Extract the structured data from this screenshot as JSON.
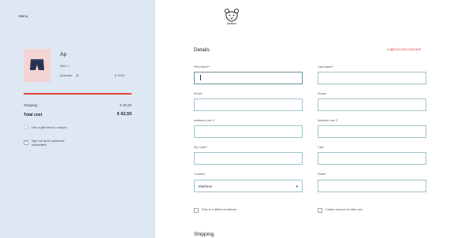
{
  "sidebar": {
    "menu_label": "Menu",
    "product": {
      "name": "Ap",
      "size": "Size: L",
      "quantity_label": "Quantity:",
      "quantity": "2",
      "price": "€ 3293"
    },
    "progress_fraction": 1.0,
    "shipping_label": "Shipping",
    "shipping_value": "€ 25,00",
    "total_label": "Total cost",
    "total_value": "€ 62,93",
    "gift_label": "Use a gift card or coupon",
    "newsletter_label": "Sign me up for awesome newsletters",
    "newsletter_checked": true
  },
  "header": {
    "logo_text": "Ardon"
  },
  "details": {
    "title": "Details",
    "signin_label": "Login to your account",
    "fields": {
      "first_name": {
        "label": "First Name*",
        "value": ""
      },
      "last_name": {
        "label": "Last Name*",
        "value": ""
      },
      "email": {
        "label": "Email*",
        "value": ""
      },
      "phone": {
        "label": "Phone",
        "value": ""
      },
      "address1": {
        "label": "Address Line 1*",
        "value": ""
      },
      "address2": {
        "label": "Address Line 2",
        "value": ""
      },
      "zip": {
        "label": "Zip Code*",
        "value": ""
      },
      "city": {
        "label": "City*",
        "value": ""
      },
      "country": {
        "label": "Country*",
        "value": "Moldova"
      },
      "state": {
        "label": "State*",
        "value": ""
      }
    },
    "ship_different_label": "Ship to a different address",
    "create_account_label": "Create account for later use"
  },
  "shipping": {
    "title": "Shipping"
  },
  "colors": {
    "sidebar_bg": "#dde8f2",
    "accent": "#e0443e",
    "input_border": "#a3c3cc"
  }
}
